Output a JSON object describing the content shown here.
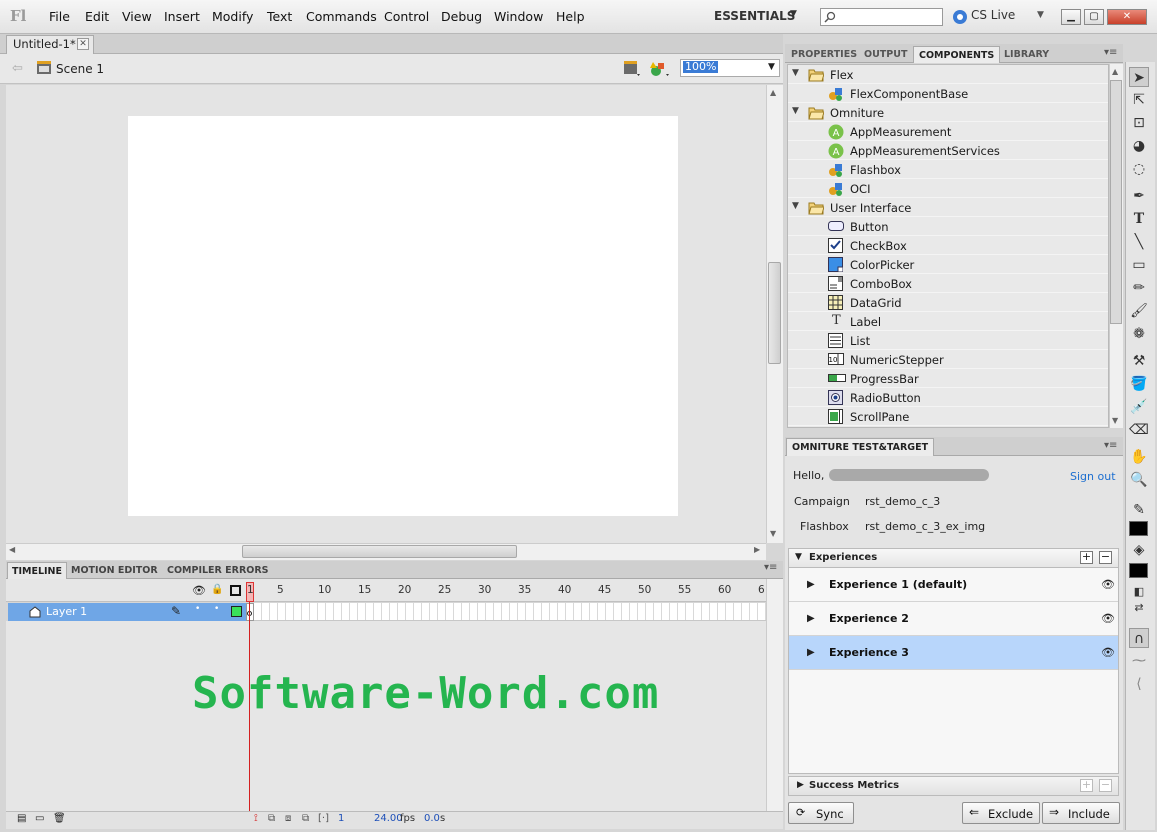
{
  "app": {
    "logo": "Fl"
  },
  "menu": [
    "File",
    "Edit",
    "View",
    "Insert",
    "Modify",
    "Text",
    "Commands",
    "Control",
    "Debug",
    "Window",
    "Help"
  ],
  "workspace": "ESSENTIALS",
  "search": {
    "placeholder": ""
  },
  "cslive": "CS Live",
  "document": {
    "tab_title": "Untitled-1*",
    "scene": "Scene 1",
    "zoom": "100%"
  },
  "timeline": {
    "tabs": [
      "TIMELINE",
      "MOTION EDITOR",
      "COMPILER ERRORS"
    ],
    "frame_numbers": [
      "1",
      "5",
      "10",
      "15",
      "20",
      "25",
      "30",
      "35",
      "40",
      "45",
      "50",
      "55",
      "60",
      "6"
    ],
    "layer": "Layer 1",
    "footer": {
      "frame": "1",
      "fps": "24.00",
      "fps_unit": "fps",
      "time": "0.0",
      "time_unit": "s"
    }
  },
  "watermark": "Software-Word.com",
  "panels": {
    "tabs": [
      "PROPERTIES",
      "OUTPUT",
      "COMPONENTS",
      "LIBRARY"
    ],
    "components": [
      {
        "label": "Flex",
        "kind": "folder",
        "icon": "folder-open-icon"
      },
      {
        "label": "FlexComponentBase",
        "kind": "item",
        "icon": "component-cube-icon"
      },
      {
        "label": "Omniture",
        "kind": "folder",
        "icon": "folder-open-icon"
      },
      {
        "label": "AppMeasurement",
        "kind": "item",
        "icon": "appmeasurement-icon"
      },
      {
        "label": "AppMeasurementServices",
        "kind": "item",
        "icon": "appmeasurement-icon"
      },
      {
        "label": "Flashbox",
        "kind": "item",
        "icon": "component-cube-icon"
      },
      {
        "label": "OCI",
        "kind": "item",
        "icon": "component-cube-icon"
      },
      {
        "label": "User Interface",
        "kind": "folder",
        "icon": "folder-open-icon"
      },
      {
        "label": "Button",
        "kind": "item",
        "icon": "button-icon"
      },
      {
        "label": "CheckBox",
        "kind": "item",
        "icon": "checkbox-icon"
      },
      {
        "label": "ColorPicker",
        "kind": "item",
        "icon": "colorpicker-icon"
      },
      {
        "label": "ComboBox",
        "kind": "item",
        "icon": "combobox-icon"
      },
      {
        "label": "DataGrid",
        "kind": "item",
        "icon": "datagrid-icon"
      },
      {
        "label": "Label",
        "kind": "item",
        "icon": "label-icon"
      },
      {
        "label": "List",
        "kind": "item",
        "icon": "list-icon"
      },
      {
        "label": "NumericStepper",
        "kind": "item",
        "icon": "numericstepper-icon"
      },
      {
        "label": "ProgressBar",
        "kind": "item",
        "icon": "progressbar-icon"
      },
      {
        "label": "RadioButton",
        "kind": "item",
        "icon": "radiobutton-icon"
      },
      {
        "label": "ScrollPane",
        "kind": "item",
        "icon": "scrollpane-icon"
      }
    ]
  },
  "omniture": {
    "tab": "OMNITURE TEST&TARGET",
    "hello": "Hello,",
    "sign_out": "Sign out",
    "campaign_label": "Campaign",
    "campaign_value": "rst_demo_c_3",
    "flashbox_label": "Flashbox",
    "flashbox_value": "rst_demo_c_3_ex_img",
    "experiences_title": "Experiences",
    "experiences": [
      "Experience 1  (default)",
      "Experience 2",
      "Experience 3"
    ],
    "selected_experience": 3,
    "success_metrics": "Success Metrics",
    "sync": "Sync",
    "exclude": "Exclude",
    "include": "Include"
  },
  "colors": {
    "accent": "#3a7bd5",
    "selected_row": "#b8d6fb",
    "layer_row": "#6fa6e6",
    "playhead": "#d42020",
    "watermark": "#25b54f"
  }
}
